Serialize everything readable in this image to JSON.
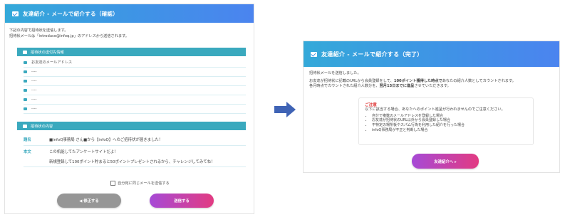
{
  "left": {
    "header_title": "友達紹介 - メールで紹介する（確認）",
    "intro_lines": [
      "下記の内容で招待状を送信します。",
      "招待状メールは「introduce@infoq.jp」のアドレスから送信されます。"
    ],
    "recipients_section_title": "招待状の送付先情報",
    "recipients": [
      "お友達のメールアドレス",
      "----",
      "----",
      "----",
      "----",
      "----"
    ],
    "content_section_title": "招待状の内容",
    "subject_label": "題名",
    "subject_value": "■infoQ事務局 さん■から【infoQ】へのご招待状が届きました！",
    "body_label": "本文",
    "body_line1": "この机能してたアンケートサイトだよ！",
    "body_line2": "新規登録して100ポイント貯まると50ポイントプレゼントされるから、チャレンジしてみてね！",
    "checkbox_label": "自分宛に同じメールを送信する",
    "back_button": "◀ 修正する",
    "send_button": "送信する"
  },
  "right": {
    "header_title": "友達紹介 - メールで紹介する（完了）",
    "line1": "招待状メールを送信しました。",
    "line2_parts": [
      "お友達が招待状に記載のURLから会員登録をして、",
      "100ポイント獲得した時点で",
      "あなたの紹介人数としてカウントされます。"
    ],
    "line3_parts": [
      "各月時点でカウントされた紹介人数分を、",
      "翌月15日までに進呈",
      "させていただきます。"
    ],
    "notice_title": "ご注意",
    "notice_intro": "以下に該当する場合、あなたへのポイント進呈が行われませんのでご注意ください。",
    "notice_items": [
      "自分で複数のメールアドレスを登録した場合",
      "お友達が招待状のURL以外から会員登録した場合",
      "不特定の場所板やスパム行為を利用した紹介を行った場合",
      "infoQ事務局が不正と判断した場合"
    ],
    "top_button": "友達紹介へ ▸"
  },
  "colors": {
    "header_gradient_start": "#34a9d9",
    "header_gradient_end": "#4b84ef",
    "section_teal": "#3aa9be",
    "accent_pink": "#e23b82",
    "accent_purple": "#a64ad6",
    "back_gray": "#969696",
    "arrow_blue": "#3f63b5"
  },
  "icons": {
    "header": "envelope-icon",
    "recipients_section": "envelope-icon",
    "content_section": "edit-icon",
    "flow_arrow": "arrow-right-icon"
  }
}
